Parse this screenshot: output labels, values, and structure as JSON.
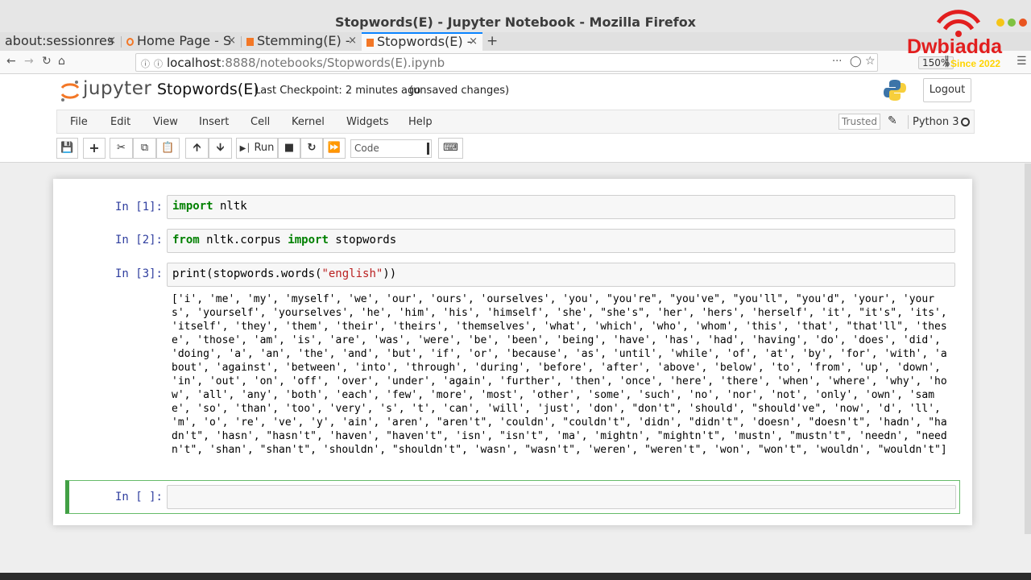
{
  "window": {
    "title": "Stopwords(E) - Jupyter Notebook - Mozilla Firefox"
  },
  "tabs": [
    {
      "label": "about:sessionres",
      "close": "×"
    },
    {
      "label": "Home Page - S",
      "close": "×"
    },
    {
      "label": "Stemming(E) -",
      "close": "×"
    },
    {
      "label": "Stopwords(E) -",
      "close": "×"
    }
  ],
  "new_tab": "+",
  "browser": {
    "url_host": "localhost",
    "url_rest": ":8888/notebooks/Stopwords(E).ipynb",
    "zoom": "150%",
    "more_icon": "···"
  },
  "watermark": {
    "text": "Dwbiadda",
    "sub": "Since 2022"
  },
  "jupyter": {
    "logo_text": "jupyter",
    "notebook_name": "Stopwords(E)",
    "checkpoint": "Last Checkpoint: 2 minutes ago",
    "unsaved": "(unsaved changes)",
    "logout": "Logout",
    "menu": [
      "File",
      "Edit",
      "View",
      "Insert",
      "Cell",
      "Kernel",
      "Widgets",
      "Help"
    ],
    "trusted": "Trusted",
    "kernel_name": "Python 3",
    "toolbar": {
      "run_label": "Run",
      "cell_type": "Code"
    }
  },
  "cells": [
    {
      "prompt": "In [1]:",
      "kw1": "import",
      "rest1": " nltk"
    },
    {
      "prompt": "In [2]:",
      "kw1": "from",
      "mid": " nltk.corpus ",
      "kw2": "import",
      "rest2": " stopwords"
    },
    {
      "prompt": "In [3]:",
      "pre": "print(stopwords.words(",
      "str": "\"english\"",
      "post": "))"
    },
    {
      "prompt": "In [ ]:"
    }
  ],
  "output": "['i', 'me', 'my', 'myself', 'we', 'our', 'ours', 'ourselves', 'you', \"you're\", \"you've\", \"you'll\", \"you'd\", 'your', 'yours', 'yourself', 'yourselves', 'he', 'him', 'his', 'himself', 'she', \"she's\", 'her', 'hers', 'herself', 'it', \"it's\", 'its', 'itself', 'they', 'them', 'their', 'theirs', 'themselves', 'what', 'which', 'who', 'whom', 'this', 'that', \"that'll\", 'these', 'those', 'am', 'is', 'are', 'was', 'were', 'be', 'been', 'being', 'have', 'has', 'had', 'having', 'do', 'does', 'did', 'doing', 'a', 'an', 'the', 'and', 'but', 'if', 'or', 'because', 'as', 'until', 'while', 'of', 'at', 'by', 'for', 'with', 'about', 'against', 'between', 'into', 'through', 'during', 'before', 'after', 'above', 'below', 'to', 'from', 'up', 'down', 'in', 'out', 'on', 'off', 'over', 'under', 'again', 'further', 'then', 'once', 'here', 'there', 'when', 'where', 'why', 'how', 'all', 'any', 'both', 'each', 'few', 'more', 'most', 'other', 'some', 'such', 'no', 'nor', 'not', 'only', 'own', 'same', 'so', 'than', 'too', 'very', 's', 't', 'can', 'will', 'just', 'don', \"don't\", 'should', \"should've\", 'now', 'd', 'll', 'm', 'o', 're', 've', 'y', 'ain', 'aren', \"aren't\", 'couldn', \"couldn't\", 'didn', \"didn't\", 'doesn', \"doesn't\", 'hadn', \"hadn't\", 'hasn', \"hasn't\", 'haven', \"haven't\", 'isn', \"isn't\", 'ma', 'mightn', \"mightn't\", 'mustn', \"mustn't\", 'needn', \"needn't\", 'shan', \"shan't\", 'shouldn', \"shouldn't\", 'wasn', \"wasn't\", 'weren', \"weren't\", 'won', \"won't\", 'wouldn', \"wouldn't\"]",
  "colors": {
    "accent": "#0a84ff",
    "prompt": "#303f9f",
    "keyword": "#008000",
    "string": "#ba2121",
    "jupyter_orange": "#f37726",
    "watermark_red": "#e21e1e",
    "selected_cell": "#42a045"
  }
}
